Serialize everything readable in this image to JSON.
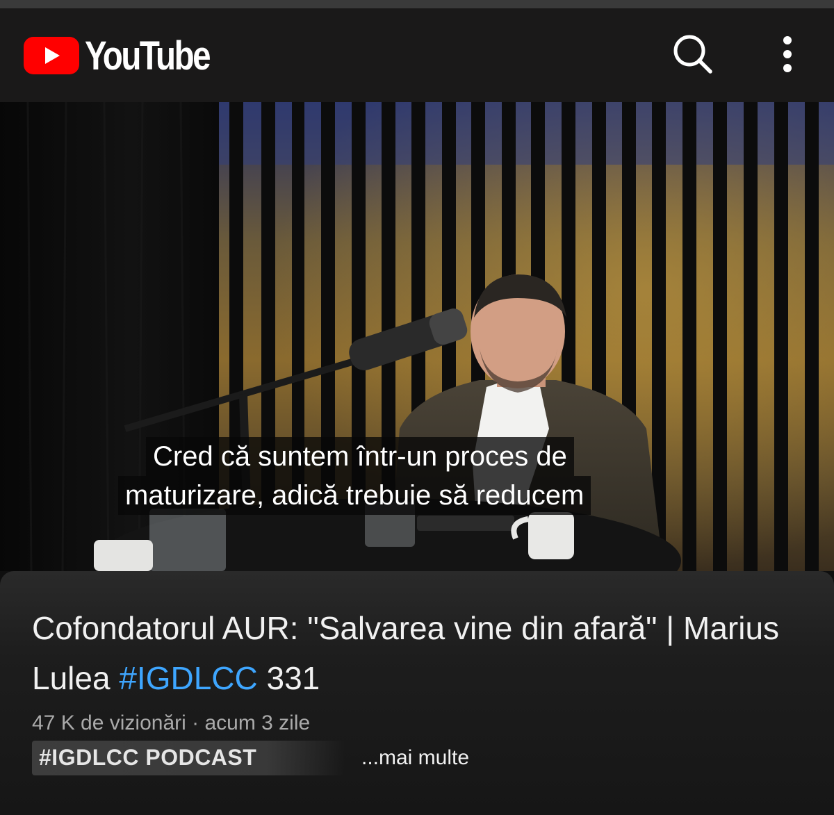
{
  "app": {
    "name": "YouTube",
    "brand_color": "#ff0000"
  },
  "header": {
    "search_icon": "search-icon",
    "menu_icon": "more-vert-icon"
  },
  "video": {
    "caption_lines": [
      "Cred că suntem într-un proces de",
      "maturizare, adică trebuie să reducem"
    ]
  },
  "details": {
    "title_prefix": "Cofondatorul AUR: \"Salvarea vine din afară\" | Marius Lulea ",
    "title_hashtag": "#IGDLCC",
    "title_suffix": " 331",
    "hashtag_color": "#3ea6ff",
    "views": "47 K de vizionări",
    "separator": " · ",
    "upload_time": "acum 3 zile",
    "channel_tag": "#IGDLCC PODCAST",
    "more_label": "...mai multe"
  }
}
